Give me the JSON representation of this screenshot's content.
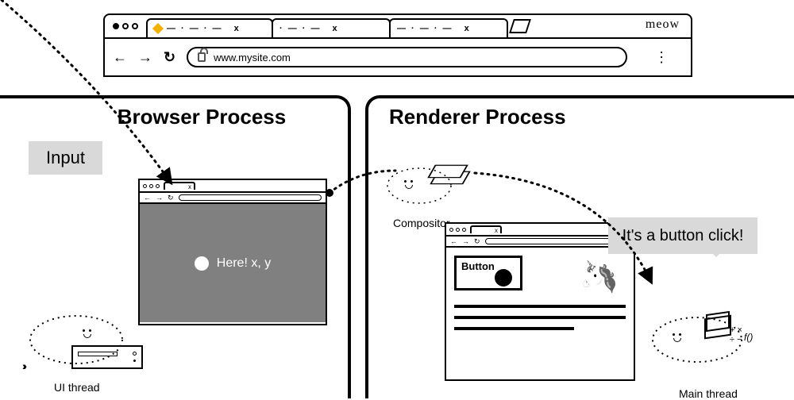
{
  "browser": {
    "brand": "meow",
    "url": "www.mysite.com",
    "tabs": [
      {
        "title": "— · — · —",
        "close": "x",
        "active": true
      },
      {
        "title": "· — · —",
        "close": "x"
      },
      {
        "title": "— · — · —",
        "close": "x"
      }
    ]
  },
  "labels": {
    "browser_process": "Browser Process",
    "renderer_process": "Renderer Process",
    "input": "Input",
    "ui_thread": "UI thread",
    "compositor": "Compositor",
    "main_thread": "Main thread"
  },
  "click_point": {
    "text": "Here! x, y"
  },
  "render_page": {
    "button_label": "Button"
  },
  "speech": {
    "text": "It's a button click!"
  }
}
